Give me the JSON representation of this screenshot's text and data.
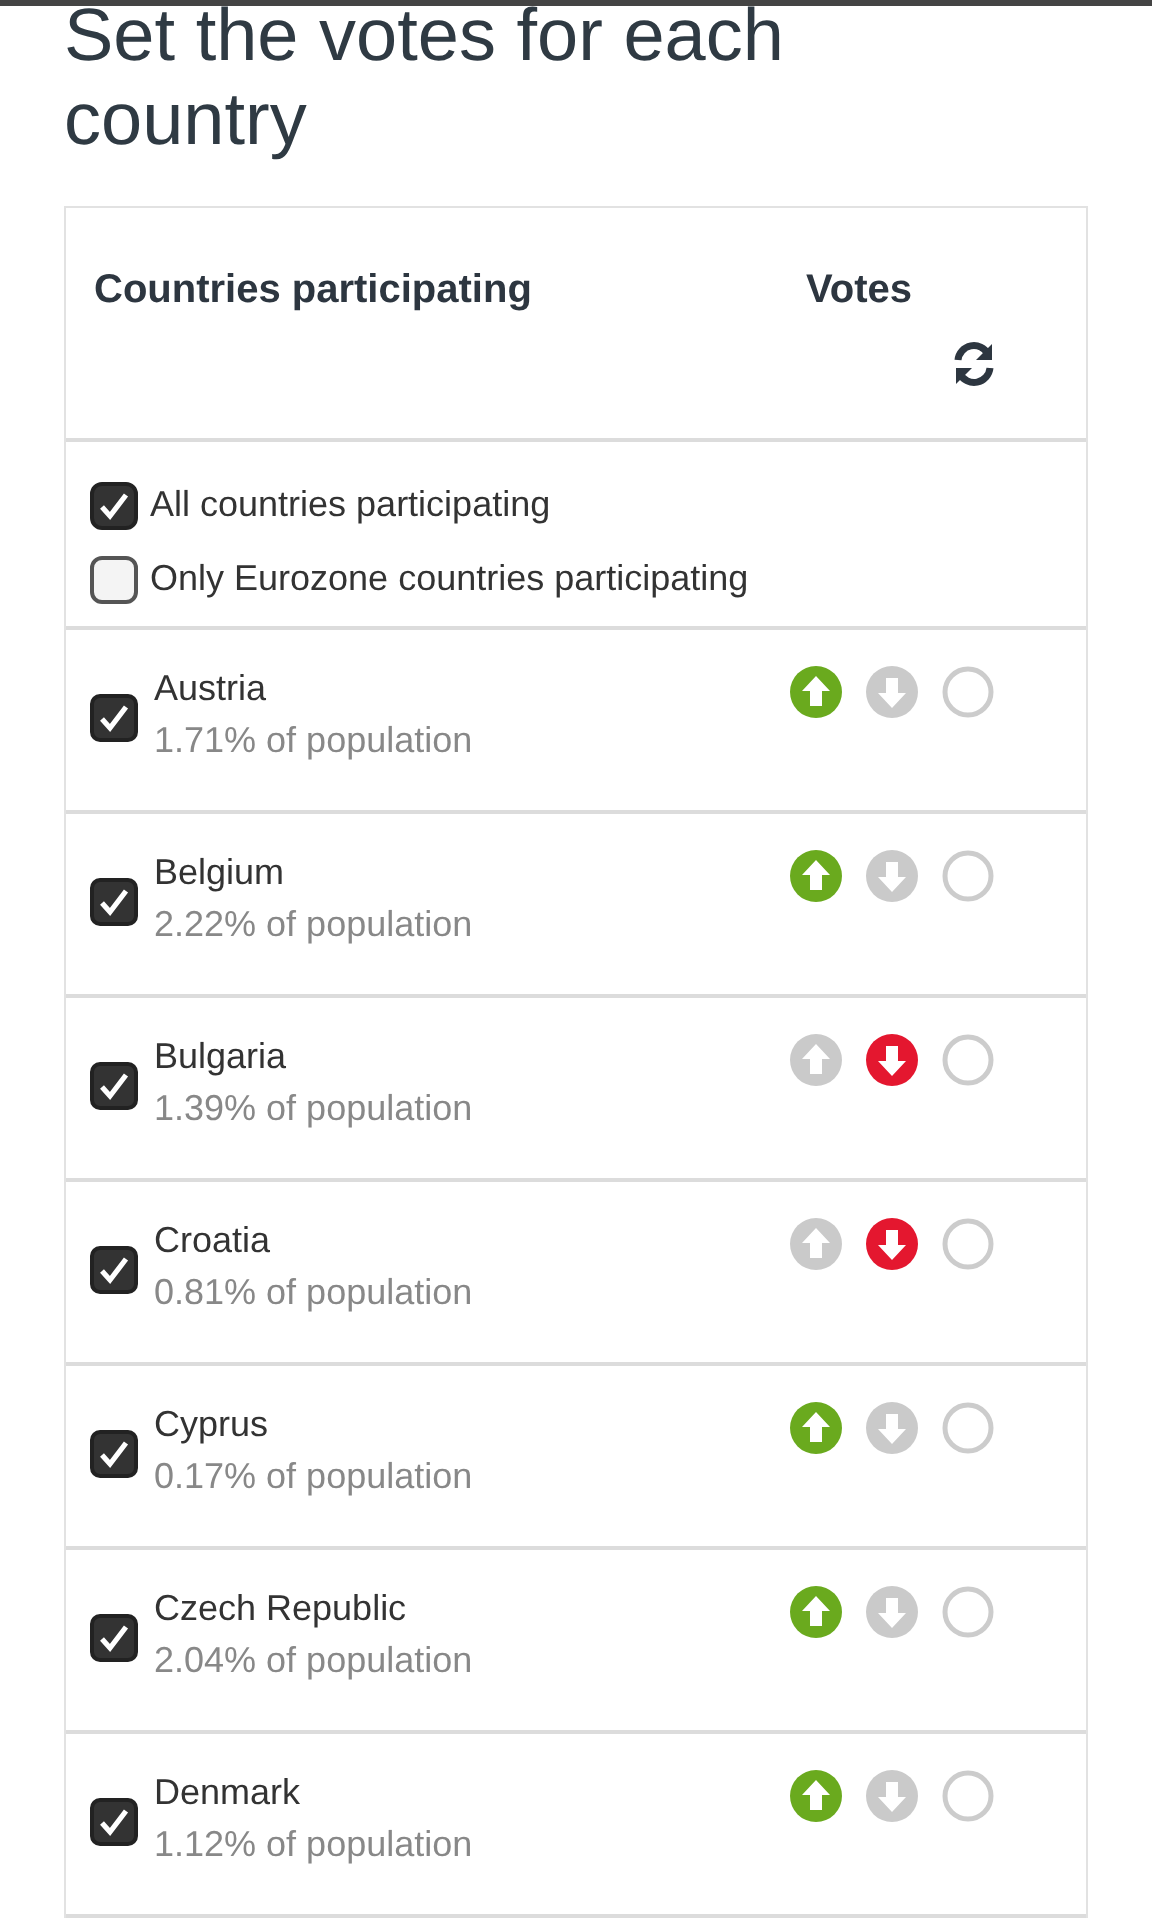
{
  "title": "Set the votes for each country",
  "table": {
    "columns": [
      "Countries participating",
      "Votes"
    ],
    "filters": [
      {
        "label": "All countries participating",
        "checked": true
      },
      {
        "label": "Only Eurozone countries participating",
        "checked": false
      }
    ],
    "rows": [
      {
        "name": "Austria",
        "share": "1.71% of population",
        "checked": true,
        "votes": [
          {
            "kind": "for",
            "selected": true
          },
          {
            "kind": "against",
            "selected": false
          },
          {
            "kind": "abstain",
            "selected": false
          }
        ]
      },
      {
        "name": "Belgium",
        "share": "2.22% of population",
        "checked": true,
        "votes": [
          {
            "kind": "for",
            "selected": true
          },
          {
            "kind": "against",
            "selected": false
          },
          {
            "kind": "abstain",
            "selected": false
          }
        ]
      },
      {
        "name": "Bulgaria",
        "share": "1.39% of population",
        "checked": true,
        "votes": [
          {
            "kind": "for",
            "selected": false
          },
          {
            "kind": "against",
            "selected": true
          },
          {
            "kind": "abstain",
            "selected": false
          }
        ]
      },
      {
        "name": "Croatia",
        "share": "0.81% of population",
        "checked": true,
        "votes": [
          {
            "kind": "for",
            "selected": false
          },
          {
            "kind": "against",
            "selected": true
          },
          {
            "kind": "abstain",
            "selected": false
          }
        ]
      },
      {
        "name": "Cyprus",
        "share": "0.17% of population",
        "checked": true,
        "votes": [
          {
            "kind": "for",
            "selected": true
          },
          {
            "kind": "against",
            "selected": false
          },
          {
            "kind": "abstain",
            "selected": false
          }
        ]
      },
      {
        "name": "Czech Republic",
        "share": "2.04% of population",
        "checked": true,
        "votes": [
          {
            "kind": "for",
            "selected": true
          },
          {
            "kind": "against",
            "selected": false
          },
          {
            "kind": "abstain",
            "selected": false
          }
        ]
      },
      {
        "name": "Denmark",
        "share": "1.12% of population",
        "checked": true,
        "votes": [
          {
            "kind": "for",
            "selected": true
          },
          {
            "kind": "against",
            "selected": false
          },
          {
            "kind": "abstain",
            "selected": false
          }
        ]
      }
    ]
  }
}
